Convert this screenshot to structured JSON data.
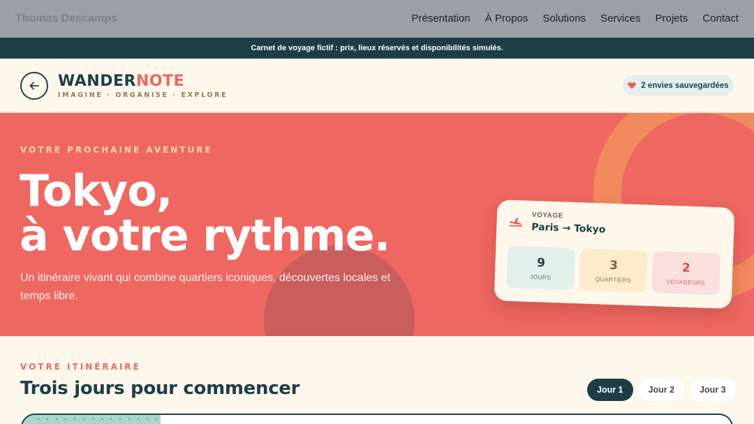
{
  "topnav": {
    "brand": "Thomas Descamps",
    "links": [
      "Présentation",
      "À Propos",
      "Solutions",
      "Services",
      "Projets",
      "Contact"
    ]
  },
  "banner": {
    "text": "Carnet de voyage fictif : prix, lieux réservés et disponibilités simulés."
  },
  "header": {
    "logo_part1": "WANDER",
    "logo_part2": "NOTE",
    "tagline": "IMAGINE · ORGANISE · EXPLORE",
    "wishlist_label": "2 envies sauvegardées",
    "back_icon": "arrow-left-icon",
    "heart_icon": "heart-icon"
  },
  "hero": {
    "eyebrow": "VOTRE PROCHAINE AVENTURE",
    "title_line1": "Tokyo,",
    "title_line2": "à votre rythme.",
    "subtitle": "Un itinéraire vivant qui combine quartiers iconiques, découvertes locales et temps libre."
  },
  "trip_card": {
    "icon": "plane-icon",
    "label": "VOYAGE",
    "route": "Paris → Tokyo",
    "stats": [
      {
        "value": "9",
        "label": "JOURS"
      },
      {
        "value": "3",
        "label": "QUARTIERS"
      },
      {
        "value": "2",
        "label": "VOYAGEURS"
      }
    ]
  },
  "itinerary": {
    "eyebrow": "VOTRE ITINÉRAIRE",
    "title": "Trois jours pour commencer",
    "tabs": [
      "Jour 1",
      "Jour 2",
      "Jour 3"
    ],
    "active_tab": "Jour 1"
  },
  "colors": {
    "coral": "#ef6761",
    "navy": "#1d3e47",
    "cream": "#fdf7ec",
    "peach": "#ffd9a6"
  }
}
